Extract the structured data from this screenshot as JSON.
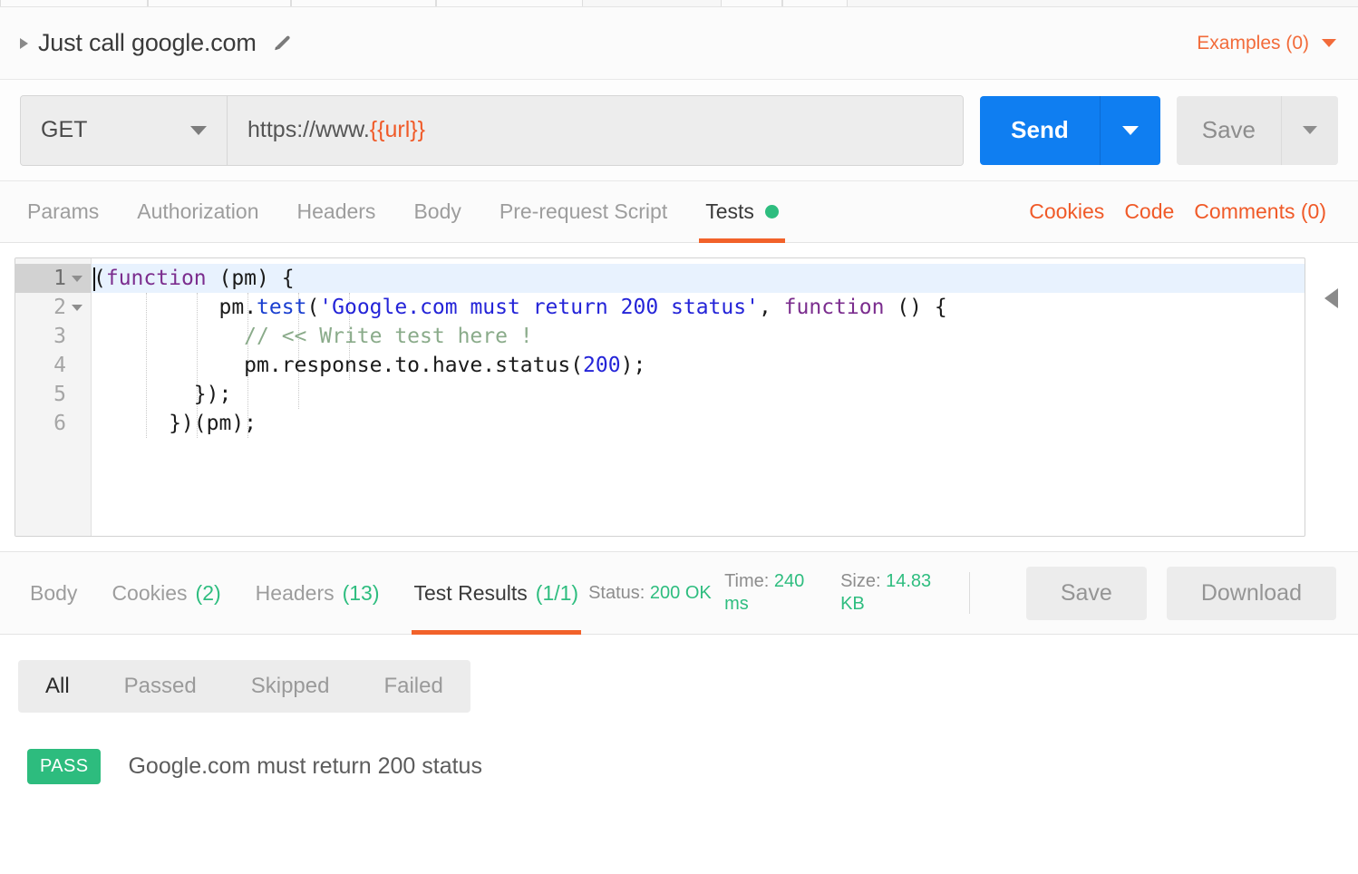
{
  "request": {
    "title": "Just call google.com",
    "collapse_icon": "triangle-right-icon",
    "edit_icon": "pencil-icon",
    "examples_label": "Examples (0)",
    "examples_caret_icon": "caret-down-icon",
    "method": "GET",
    "method_caret_icon": "caret-down-icon",
    "url_prefix": "https://www.",
    "url_variable": "{{url}}",
    "send_label": "Send",
    "send_caret_icon": "caret-down-icon",
    "save_label": "Save",
    "save_caret_icon": "caret-down-icon"
  },
  "request_tabs": {
    "items": [
      {
        "label": "Params",
        "active": false,
        "dot": false
      },
      {
        "label": "Authorization",
        "active": false,
        "dot": false
      },
      {
        "label": "Headers",
        "active": false,
        "dot": false
      },
      {
        "label": "Body",
        "active": false,
        "dot": false
      },
      {
        "label": "Pre-request Script",
        "active": false,
        "dot": false
      },
      {
        "label": "Tests",
        "active": true,
        "dot": true
      }
    ],
    "links": [
      "Cookies",
      "Code",
      "Comments (0)"
    ]
  },
  "editor": {
    "collapse_icon": "triangle-left-icon",
    "lines": [
      {
        "number": "1",
        "foldable": true,
        "active": true
      },
      {
        "number": "2",
        "foldable": true,
        "active": false
      },
      {
        "number": "3",
        "foldable": false,
        "active": false
      },
      {
        "number": "4",
        "foldable": false,
        "active": false
      },
      {
        "number": "5",
        "foldable": false,
        "active": false
      },
      {
        "number": "6",
        "foldable": false,
        "active": false
      }
    ],
    "code": {
      "l1_a": "(",
      "l1_kw": "function",
      "l1_b": " (pm) {",
      "l2_indent": "          ",
      "l2_obj": "pm",
      "l2_dot": ".",
      "l2_fn": "test",
      "l2_paren": "(",
      "l2_str": "'Google.com must return 200 status'",
      "l2_comma": ", ",
      "l2_kw": "function",
      "l2_tail": " () {",
      "l3_indent": "            ",
      "l3_comment": "// << Write test here !",
      "l4_indent": "            ",
      "l4_expr_a": "pm.response.to.have.status(",
      "l4_num": "200",
      "l4_expr_b": ");",
      "l5": "        });",
      "l6": "      })(pm);"
    }
  },
  "response": {
    "tabs": [
      {
        "label": "Body",
        "count": "",
        "active": false
      },
      {
        "label": "Cookies",
        "count": "(2)",
        "active": false
      },
      {
        "label": "Headers",
        "count": "(13)",
        "active": false
      },
      {
        "label": "Test Results",
        "count": "(1/1)",
        "active": true
      }
    ],
    "metrics": [
      {
        "label": "Status:",
        "value": "200 OK"
      },
      {
        "label": "Time:",
        "value": "240 ms"
      },
      {
        "label": "Size:",
        "value": "14.83 KB"
      }
    ],
    "save_label": "Save",
    "download_label": "Download"
  },
  "test_results": {
    "filters": [
      {
        "label": "All",
        "active": true
      },
      {
        "label": "Passed",
        "active": false
      },
      {
        "label": "Skipped",
        "active": false
      },
      {
        "label": "Failed",
        "active": false
      }
    ],
    "rows": [
      {
        "status": "PASS",
        "name": "Google.com must return 200 status"
      }
    ]
  },
  "colors": {
    "accent_orange": "#f2622a",
    "send_blue": "#0f7ef1",
    "pass_green": "#2dbc7e",
    "muted_gray": "#9d9d9d"
  }
}
